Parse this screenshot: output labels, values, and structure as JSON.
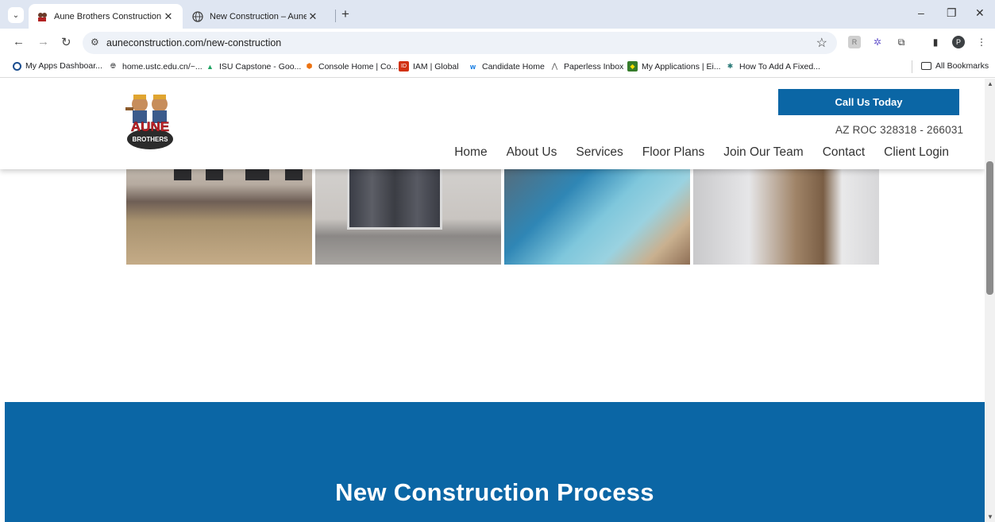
{
  "browser": {
    "tabs": [
      {
        "title": "Aune Brothers Construction",
        "active": true,
        "favicon": "aune-logo-icon"
      },
      {
        "title": "New Construction – Aune Cons",
        "active": false,
        "favicon": "globe-icon"
      }
    ],
    "url": "auneconstruction.com/new-construction",
    "bookmarks": [
      {
        "label": "My Apps Dashboar...",
        "icon": "circle-icon"
      },
      {
        "label": "home.ustc.edu.cn/~...",
        "icon": "globe-icon"
      },
      {
        "label": "ISU Capstone - Goo...",
        "icon": "drive-icon"
      },
      {
        "label": "Console Home | Co...",
        "icon": "aws-icon"
      },
      {
        "label": "IAM | Global",
        "icon": "iam-icon"
      },
      {
        "label": "Candidate Home",
        "icon": "workday-icon"
      },
      {
        "label": "Paperless Inbox",
        "icon": "paperless-icon"
      },
      {
        "label": "My Applications | Ei...",
        "icon": "deere-icon"
      },
      {
        "label": "How To Add A Fixed...",
        "icon": "star-icon"
      }
    ],
    "all_bookmarks": "All Bookmarks",
    "profile_initial": "P"
  },
  "site": {
    "cta": "Call Us Today",
    "license": "AZ ROC 328318 - 266031",
    "nav": [
      "Home",
      "About Us",
      "Services",
      "Floor Plans",
      "Join Our Team",
      "Contact",
      "Client Login"
    ],
    "logo_text": [
      "AUNE",
      "BROTHERS"
    ],
    "section_title": "New Construction Process"
  },
  "colors": {
    "brand_blue": "#0b66a5",
    "tab_strip": "#dfe6f2"
  }
}
